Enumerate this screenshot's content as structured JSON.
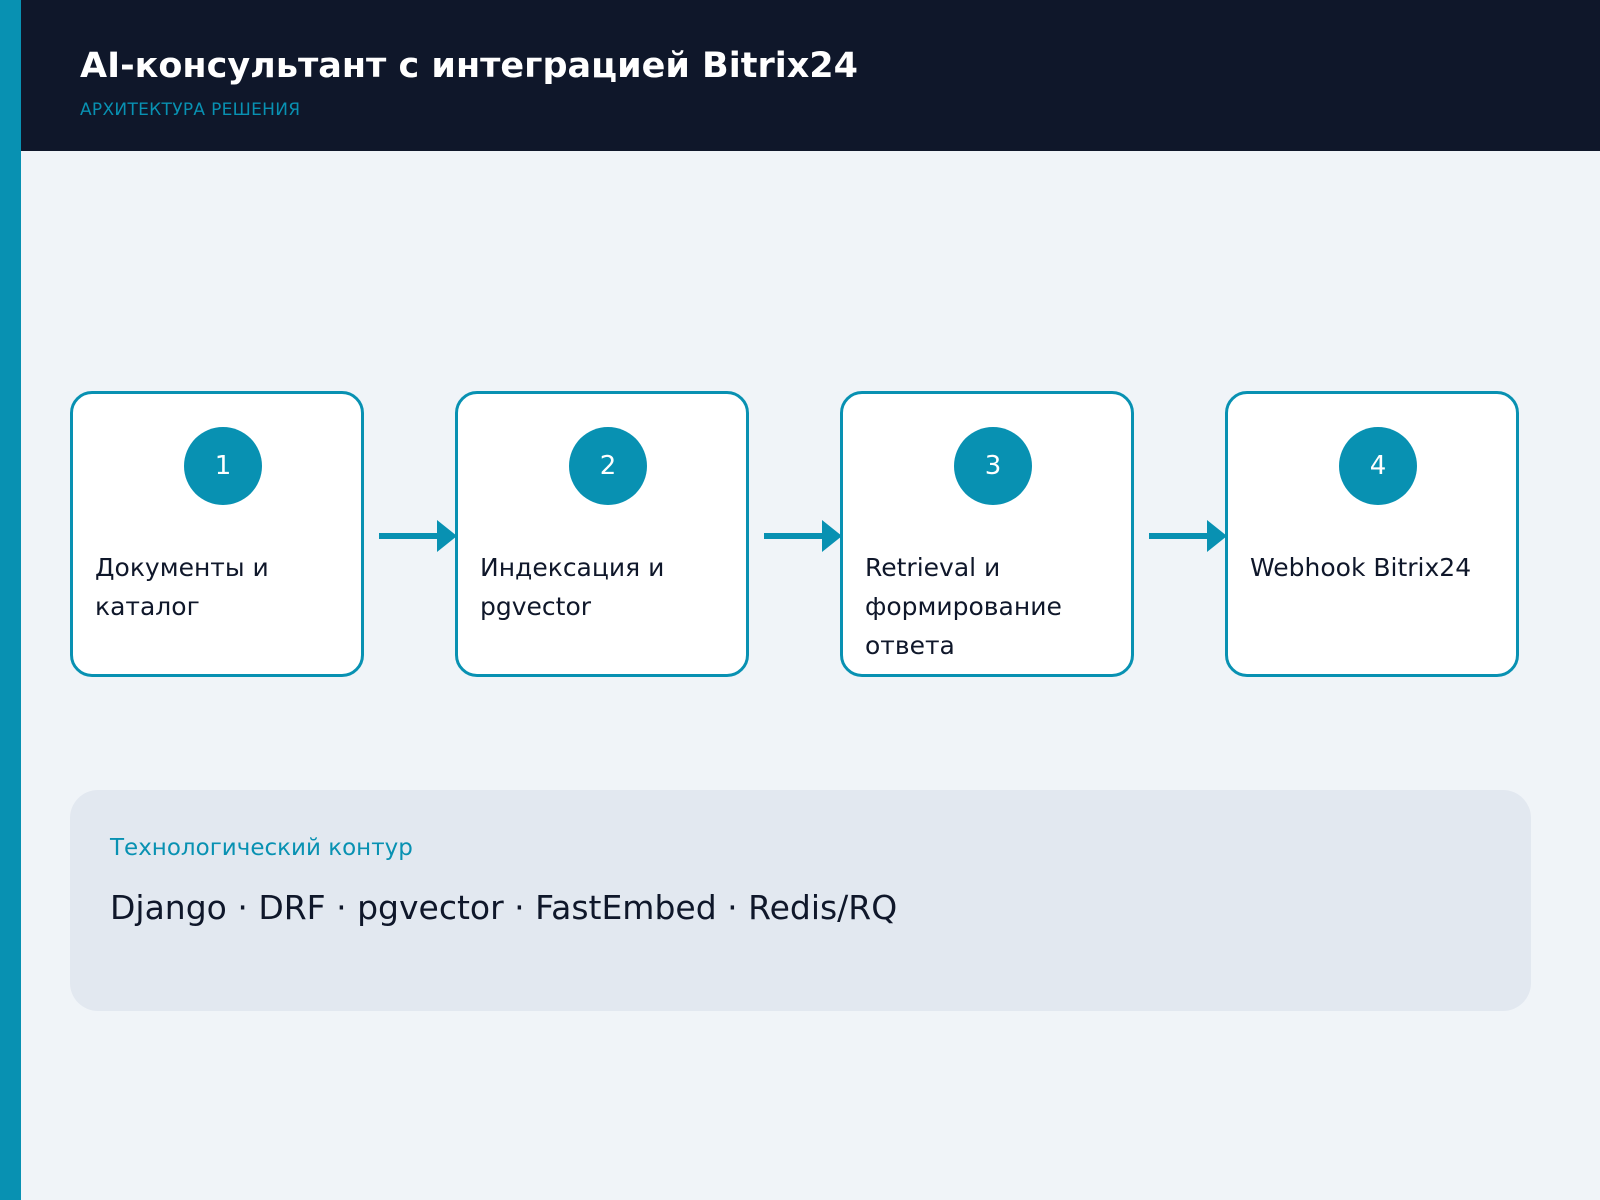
{
  "header": {
    "title": "AI-консультант с интеграцией Bitrix24",
    "subtitle": "АРХИТЕКТУРА РЕШЕНИЯ"
  },
  "steps": [
    {
      "number": "1",
      "title": "Документы и каталог"
    },
    {
      "number": "2",
      "title": "Индексация и pgvector"
    },
    {
      "number": "3",
      "title": "Retrieval и формирование ответа"
    },
    {
      "number": "4",
      "title": "Webhook Bitrix24"
    }
  ],
  "tech": {
    "label": "Технологический контур",
    "stack": "Django · DRF · pgvector · FastEmbed · Redis/RQ"
  },
  "colors": {
    "accent": "#0891b2",
    "header_bg": "#0f172a",
    "page_bg": "#f0f4f8",
    "panel_bg": "#e2e8f0",
    "card_bg": "#ffffff"
  }
}
